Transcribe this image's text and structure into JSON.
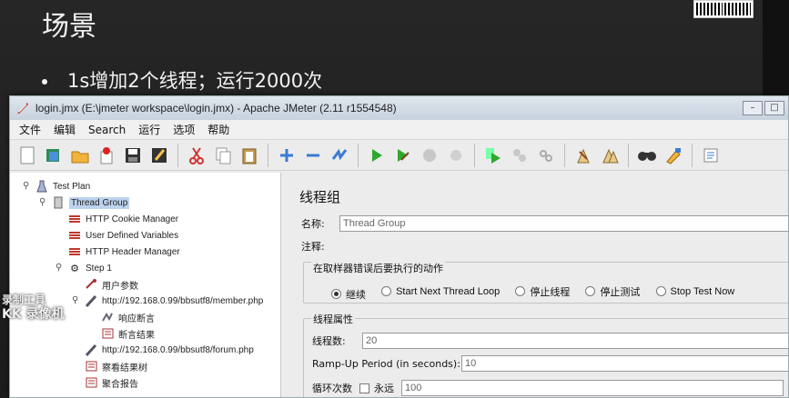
{
  "slide": {
    "title": "场景",
    "bullet": "1s增加2个线程；运行2000次"
  },
  "window": {
    "title": "login.jmx (E:\\jmeter workspace\\login.jmx) - Apache JMeter (2.11 r1554548)",
    "buttons": [
      "–",
      "□"
    ]
  },
  "menu": [
    "文件",
    "编辑",
    "Search",
    "运行",
    "选项",
    "帮助"
  ],
  "toolbar_icons": [
    "new-icon",
    "templates-icon",
    "open-icon",
    "close-icon",
    "save-icon",
    "save-as-icon",
    "cut-icon",
    "copy-icon",
    "paste-icon",
    "expand-icon",
    "collapse-icon",
    "toggle-icon",
    "start-icon",
    "start-no-pause-icon",
    "stop-icon",
    "shutdown-icon",
    "remote-start-icon",
    "remote-stop-icon",
    "remote-shutdown-icon",
    "clear-icon",
    "clear-all-icon",
    "search-icon",
    "reset-search-icon",
    "function-helper-icon"
  ],
  "tree": [
    {
      "label": "Test Plan",
      "icon": "flask-icon"
    },
    {
      "label": "Thread Group",
      "icon": "thread-group-icon"
    },
    {
      "label": "HTTP Cookie Manager",
      "icon": "config-icon"
    },
    {
      "label": "User Defined Variables",
      "icon": "config-icon"
    },
    {
      "label": "HTTP Header Manager",
      "icon": "config-icon"
    },
    {
      "label": "Step 1",
      "icon": "gear-icon"
    },
    {
      "label": "用户参数",
      "icon": "preprocessor-icon"
    },
    {
      "label": "http://192.168.0.99/bbsutf8/member.php",
      "icon": "sampler-icon"
    },
    {
      "label": "响应断言",
      "icon": "assertion-icon"
    },
    {
      "label": "断言结果",
      "icon": "listener-icon"
    },
    {
      "label": "http://192.168.0.99/bbsutf8/forum.php",
      "icon": "sampler-icon"
    },
    {
      "label": "察看结果树",
      "icon": "listener-icon"
    },
    {
      "label": "聚合报告",
      "icon": "listener-icon"
    }
  ],
  "panel": {
    "title": "线程组",
    "name_label": "名称:",
    "name_value": "Thread Group",
    "comment_label": "注释:",
    "error_group_title": "在取样器错误后要执行的动作",
    "error_options": [
      {
        "label": "继续",
        "selected": true
      },
      {
        "label": "Start Next Thread Loop",
        "selected": false
      },
      {
        "label": "停止线程",
        "selected": false
      },
      {
        "label": "停止测试",
        "selected": false
      },
      {
        "label": "Stop Test Now",
        "selected": false
      }
    ],
    "thread_props_title": "线程属性",
    "threads_label": "线程数:",
    "threads_value": "20",
    "rampup_label": "Ramp-Up Period (in seconds):",
    "rampup_value": "10",
    "loop_label": "循环次数",
    "forever_label": "永远",
    "loop_value": "100"
  },
  "watermark": {
    "line1": "录制工具",
    "line2": "KK 录像机"
  }
}
